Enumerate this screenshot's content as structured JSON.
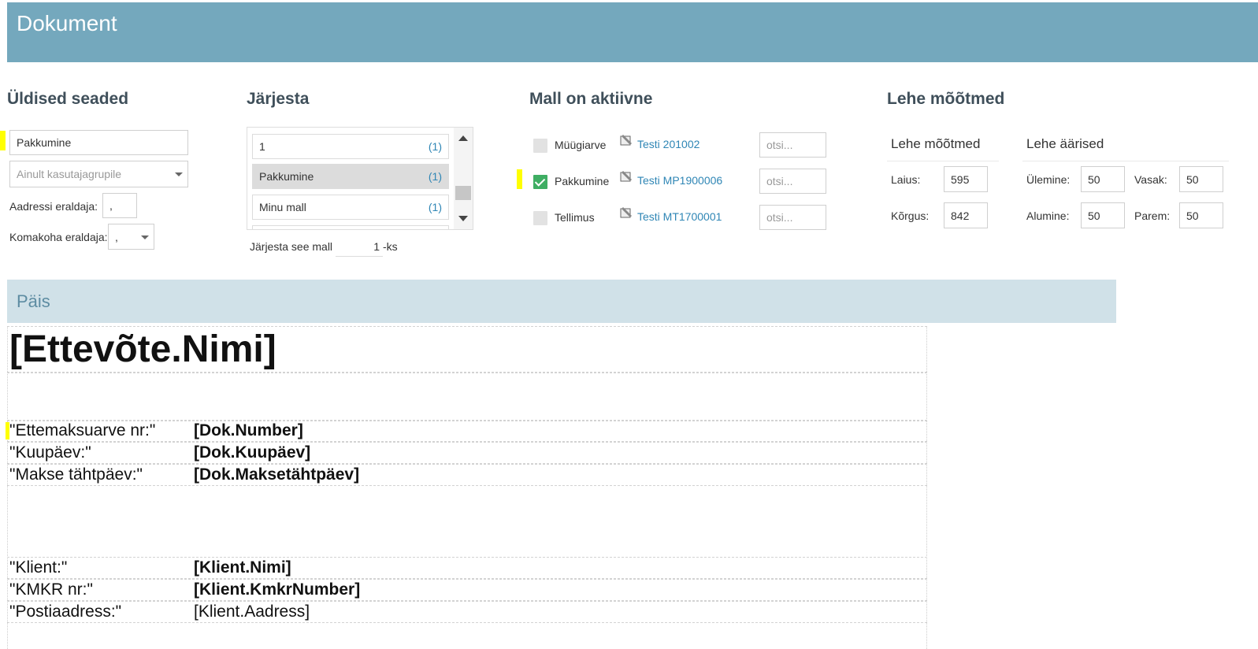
{
  "header": {
    "title": "Dokument"
  },
  "general": {
    "title": "Üldised seaded",
    "name_value": "Pakkumine",
    "group_placeholder": "Ainult kasutajagrupile",
    "address_sep_label": "Aadressi eraldaja:",
    "address_sep_value": ",",
    "decimal_sep_label": "Komakoha eraldaja:",
    "decimal_sep_value": ","
  },
  "sort": {
    "title": "Järjesta",
    "items": [
      {
        "label": "1",
        "count": "(1)"
      },
      {
        "label": "Pakkumine",
        "count": "(1)"
      },
      {
        "label": "Minu mall",
        "count": "(1)"
      }
    ],
    "order_label": "Järjesta see mall",
    "order_value": "1",
    "order_suffix": "-ks"
  },
  "active": {
    "title": "Mall on aktiivne",
    "rows": [
      {
        "name": "Müügiarve",
        "template": "Testi 201002",
        "checked": false,
        "search_placeholder": "otsi..."
      },
      {
        "name": "Pakkumine",
        "template": "Testi MP1900006",
        "checked": true,
        "search_placeholder": "otsi..."
      },
      {
        "name": "Tellimus",
        "template": "Testi MT1700001",
        "checked": false,
        "search_placeholder": "otsi..."
      }
    ]
  },
  "page_size": {
    "title": "Lehe mõõtmed",
    "dimensions_title": "Lehe mõõtmed",
    "margins_title": "Lehe äärised",
    "width_label": "Laius:",
    "width_value": "595",
    "height_label": "Kõrgus:",
    "height_value": "842",
    "top_label": "Ülemine:",
    "top_value": "50",
    "left_label": "Vasak:",
    "left_value": "50",
    "bottom_label": "Alumine:",
    "bottom_value": "50",
    "right_label": "Parem:",
    "right_value": "50"
  },
  "section": {
    "title": "Päis"
  },
  "layout": {
    "company_name": "[Ettevõte.Nimi]",
    "doc_fields": [
      {
        "label": "\"Ettemaksuarve nr:\"",
        "value": "[Dok.Number]"
      },
      {
        "label": "\"Kuupäev:\"",
        "value": "[Dok.Kuupäev]"
      },
      {
        "label": "\"Makse tähtpäev:\"",
        "value": "[Dok.Maksetähtpäev]"
      }
    ],
    "client_fields": [
      {
        "label": "\"Klient:\"",
        "value": "[Klient.Nimi]"
      },
      {
        "label": "\"KMKR nr:\"",
        "value": "[Klient.KmkrNumber]"
      },
      {
        "label": "\"Postiaadress:\"",
        "value": "[Klient.Aadress]"
      }
    ]
  },
  "colors": {
    "header": "#74a8bd",
    "band": "#d0e1e8",
    "link": "#2f86b5",
    "check": "#3fae63",
    "highlight": "#ffff00"
  }
}
